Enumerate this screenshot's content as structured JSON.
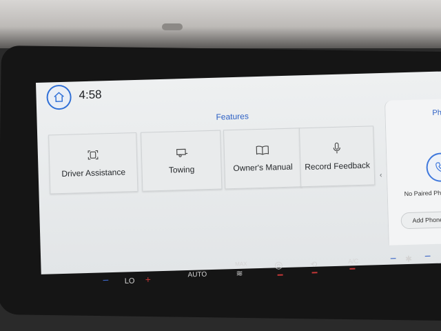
{
  "status_bar": {
    "time": "4:58",
    "home_icon": "home-icon"
  },
  "features": {
    "title": "Features",
    "tiles": [
      {
        "label": "Driver Assistance",
        "icon": "driver-assist-icon"
      },
      {
        "label": "Towing",
        "icon": "trailer-icon"
      },
      {
        "label": "Owner's Manual",
        "icon": "book-icon"
      },
      {
        "label": "Record Feedback",
        "icon": "microphone-icon"
      }
    ]
  },
  "phone_panel": {
    "title": "Phon",
    "status": "No Paired Phone",
    "add_label": "Add Phone",
    "icon": "phone-icon"
  },
  "climate": {
    "temp_left": "LO",
    "auto_label": "AUTO",
    "max_label": "MAX",
    "ac_label": "A/C"
  },
  "colors": {
    "accent": "#2f6fd6",
    "screen_bg": "#e9ebec",
    "heat_red": "#c43737",
    "cool_blue": "#3d67c7"
  }
}
